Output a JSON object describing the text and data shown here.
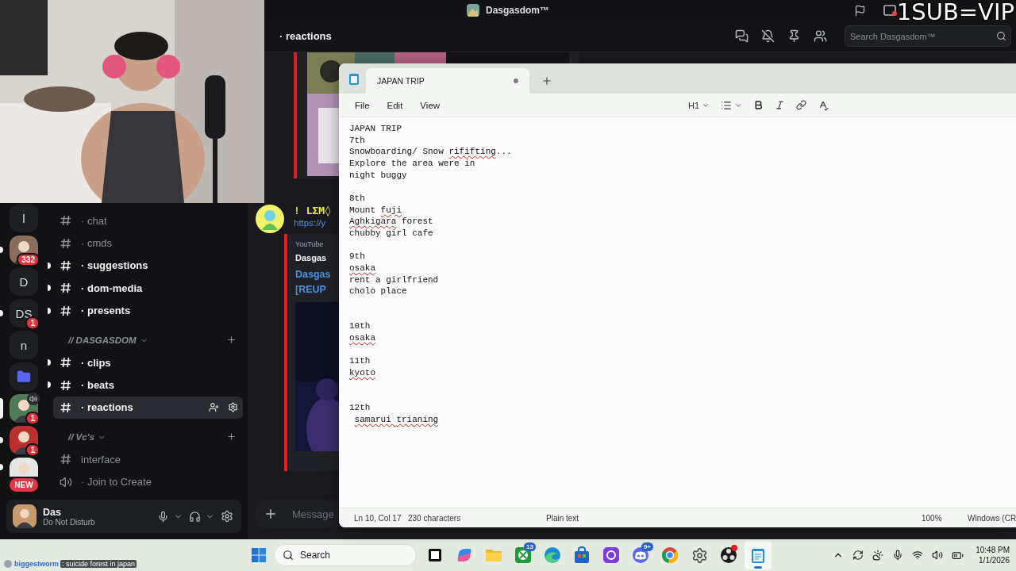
{
  "title_bar": {
    "server_name": "Dasgasdom™",
    "overlay_text": "1SUB=VIP"
  },
  "servers": [
    {
      "kind": "letter",
      "label": "l",
      "unread": false,
      "selected": false,
      "in_voice": false
    },
    {
      "kind": "avatar",
      "badge": "332",
      "unread": true,
      "selected": false,
      "in_voice": false
    },
    {
      "kind": "letter",
      "label": "D",
      "unread": false,
      "selected": false,
      "in_voice": false
    },
    {
      "kind": "letter",
      "label": "DS",
      "badge": "1",
      "unread": true,
      "selected": false,
      "in_voice": false
    },
    {
      "kind": "letter",
      "label": "n",
      "unread": false,
      "selected": false,
      "in_voice": false
    },
    {
      "kind": "folder",
      "unread": false,
      "selected": false,
      "in_voice": false
    },
    {
      "kind": "avatar",
      "badge": "1",
      "unread": false,
      "selected": true,
      "in_voice": true
    },
    {
      "kind": "avatar",
      "badge": "1",
      "unread": true,
      "selected": false,
      "in_voice": false
    },
    {
      "kind": "avatar",
      "unread": true,
      "selected": false,
      "in_voice": false
    }
  ],
  "rail_notice": "NEW",
  "channels": [
    {
      "kind": "text",
      "label": "· chat",
      "unread": false,
      "selected": false
    },
    {
      "kind": "text",
      "label": "· cmds",
      "unread": false,
      "selected": false
    },
    {
      "kind": "text",
      "label": "· suggestions",
      "unread": true,
      "selected": false
    },
    {
      "kind": "text",
      "label": "· dom-media",
      "unread": true,
      "selected": false
    },
    {
      "kind": "text",
      "label": "· presents",
      "unread": true,
      "selected": false
    },
    {
      "kind": "category",
      "label": "// DASGASDOM",
      "expanded": true
    },
    {
      "kind": "text",
      "label": "· clips",
      "unread": true,
      "selected": false
    },
    {
      "kind": "text",
      "label": "· beats",
      "unread": true,
      "selected": false
    },
    {
      "kind": "text",
      "label": "· reactions",
      "unread": false,
      "selected": true
    },
    {
      "kind": "category",
      "label": "// Vc's",
      "expanded": true
    },
    {
      "kind": "text",
      "label": "interface",
      "unread": false,
      "selected": false
    },
    {
      "kind": "voice",
      "label": "· Join to Create",
      "unread": false,
      "selected": false
    }
  ],
  "user": {
    "name": "Das",
    "status": "Do Not Disturb"
  },
  "chat": {
    "channel": "· reactions",
    "search_placeholder": "Search Dasgasdom™",
    "composer_placeholder": "Message",
    "messages": [
      {
        "kind": "image_embed"
      },
      {
        "kind": "link_embed",
        "author": "! LΣM◊",
        "link": "https://y",
        "embed": {
          "provider": "YouTube",
          "author": "Dasgas",
          "title_lines": [
            "Dasgas",
            "[REUP"
          ]
        }
      }
    ]
  },
  "notepad": {
    "tab_title": "JAPAN TRIP",
    "unsaved": true,
    "menu": [
      "File",
      "Edit",
      "View"
    ],
    "heading": "H1",
    "lines": [
      {
        "kind": "text",
        "indented": false,
        "segments": [
          {
            "text": "JAPAN TRIP",
            "misspelled": false
          }
        ]
      },
      {
        "kind": "text",
        "indented": false,
        "segments": [
          {
            "text": "7th",
            "misspelled": false
          }
        ]
      },
      {
        "kind": "text",
        "indented": false,
        "segments": [
          {
            "text": "Snowboarding/ Snow ",
            "misspelled": false
          },
          {
            "text": "rififting",
            "misspelled": true
          },
          {
            "text": "...",
            "misspelled": false
          }
        ]
      },
      {
        "kind": "text",
        "indented": false,
        "segments": [
          {
            "text": "Explore the area were in",
            "misspelled": false
          }
        ]
      },
      {
        "kind": "text",
        "indented": false,
        "segments": [
          {
            "text": "night buggy",
            "misspelled": false
          }
        ]
      },
      {
        "kind": "blank"
      },
      {
        "kind": "text",
        "indented": false,
        "segments": [
          {
            "text": "8th",
            "misspelled": false
          }
        ]
      },
      {
        "kind": "text",
        "indented": false,
        "segments": [
          {
            "text": "Mount ",
            "misspelled": false
          },
          {
            "text": "fuji",
            "misspelled": true
          }
        ]
      },
      {
        "kind": "text",
        "indented": false,
        "segments": [
          {
            "text": "Aghkigara",
            "misspelled": true
          },
          {
            "text": " forest",
            "misspelled": false
          }
        ]
      },
      {
        "kind": "text",
        "indented": false,
        "segments": [
          {
            "text": "chubby girl cafe",
            "misspelled": false
          }
        ]
      },
      {
        "kind": "blank"
      },
      {
        "kind": "text",
        "indented": false,
        "segments": [
          {
            "text": "9th",
            "misspelled": false
          }
        ]
      },
      {
        "kind": "text",
        "indented": false,
        "segments": [
          {
            "text": "osaka",
            "misspelled": true
          }
        ]
      },
      {
        "kind": "text",
        "indented": false,
        "segments": [
          {
            "text": "rent a girlfriend",
            "misspelled": false
          }
        ]
      },
      {
        "kind": "text",
        "indented": false,
        "segments": [
          {
            "text": "cholo place",
            "misspelled": false
          }
        ]
      },
      {
        "kind": "blank"
      },
      {
        "kind": "blank"
      },
      {
        "kind": "text",
        "indented": false,
        "segments": [
          {
            "text": "10th",
            "misspelled": false
          }
        ]
      },
      {
        "kind": "text",
        "indented": false,
        "segments": [
          {
            "text": "osaka",
            "misspelled": true
          }
        ]
      },
      {
        "kind": "blank"
      },
      {
        "kind": "text",
        "indented": false,
        "segments": [
          {
            "text": "11th",
            "misspelled": false
          }
        ]
      },
      {
        "kind": "text",
        "indented": false,
        "segments": [
          {
            "text": "kyoto",
            "misspelled": true
          }
        ]
      },
      {
        "kind": "blank"
      },
      {
        "kind": "blank"
      },
      {
        "kind": "text",
        "indented": false,
        "segments": [
          {
            "text": "12th",
            "misspelled": false
          }
        ]
      },
      {
        "kind": "text",
        "indented": true,
        "segments": [
          {
            "text": "samarui ",
            "misspelled": true
          },
          {
            "text": "trianing",
            "misspelled": true
          }
        ]
      }
    ],
    "status": {
      "position": "Ln 10, Col 17",
      "count": "230 characters",
      "format": "Plain text",
      "zoom": "100%",
      "line_ending": "Windows (CR"
    }
  },
  "taskbar": {
    "search_placeholder": "Search",
    "time": "10:48 PM",
    "date": "1/1/2026",
    "apps": [
      {
        "kind": "taskview",
        "selected": false,
        "alert": false
      },
      {
        "kind": "copilot",
        "selected": false,
        "alert": false
      },
      {
        "kind": "files",
        "selected": false,
        "alert": false
      },
      {
        "kind": "xbox",
        "badge": "13",
        "selected": false,
        "alert": false
      },
      {
        "kind": "edge",
        "selected": false,
        "alert": false
      },
      {
        "kind": "store",
        "selected": false,
        "alert": false
      },
      {
        "kind": "loop",
        "selected": false,
        "alert": false
      },
      {
        "kind": "discord",
        "badge": "9+",
        "selected": false,
        "alert": false
      },
      {
        "kind": "chrome",
        "selected": false,
        "alert": false
      },
      {
        "kind": "settings",
        "selected": false,
        "alert": false
      },
      {
        "kind": "obs",
        "selected": false,
        "alert": true
      },
      {
        "kind": "notepad",
        "selected": true,
        "alert": false
      }
    ]
  },
  "stream_chat": {
    "user": "biggestworm",
    "message": ": suicide forest in japan"
  }
}
